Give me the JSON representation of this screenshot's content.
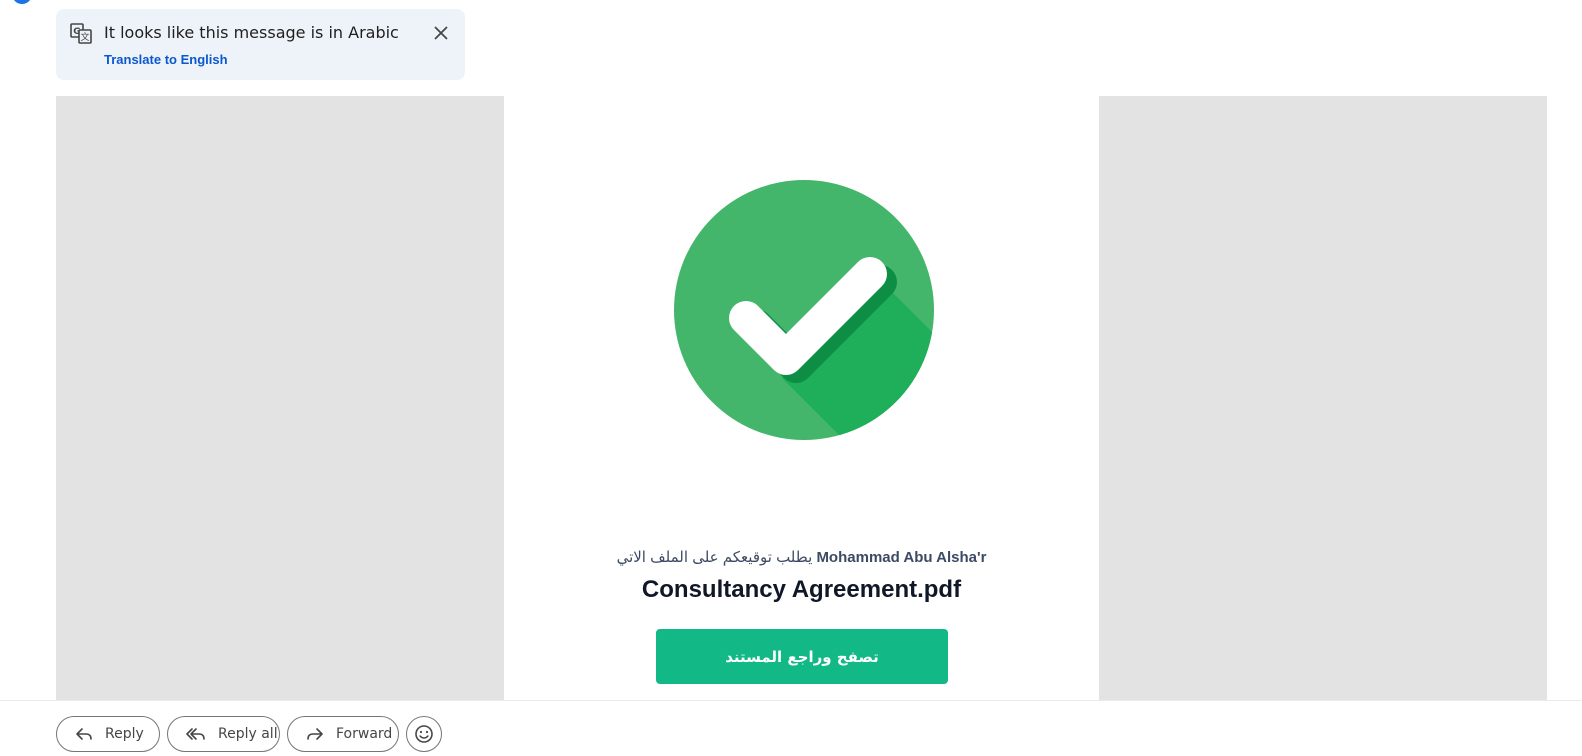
{
  "translate_banner": {
    "message": "It looks like this message is in Arabic",
    "link": "Translate to English",
    "icon": "translate-icon",
    "close_icon": "close-icon"
  },
  "email": {
    "sender_name": "Mohammad Abu Alsha'r",
    "request_text": "يطلب توقيعكم على الملف الاتي",
    "file_name": "Consultancy Agreement.pdf",
    "button_label": "تصفح وراجع المستند",
    "button_color": "#12b886",
    "check_icon": "check-circle-icon",
    "check_color": "#43b66b"
  },
  "actions": {
    "reply": "Reply",
    "reply_all": "Reply all",
    "forward": "Forward",
    "emoji_icon": "emoji-icon"
  }
}
